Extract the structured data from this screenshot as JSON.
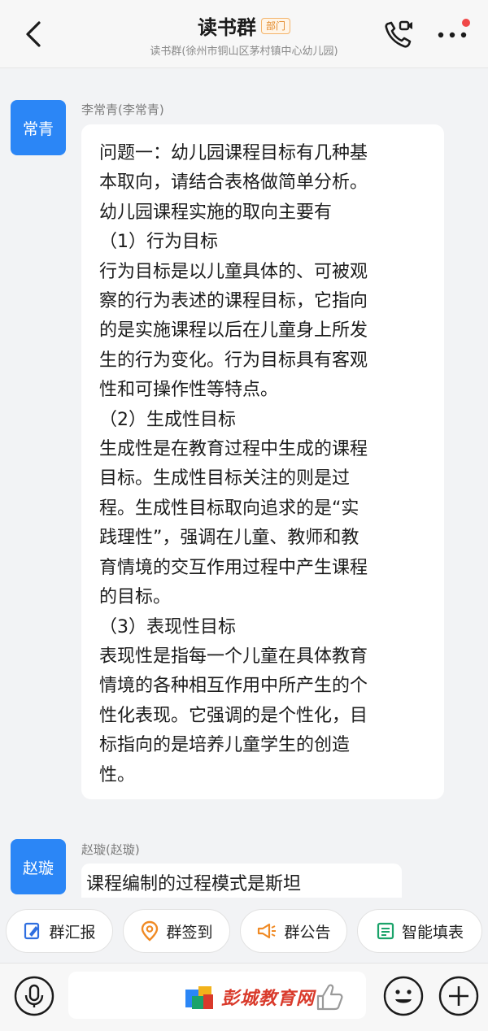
{
  "header": {
    "title": "读书群",
    "tag": "部门",
    "subtitle": "读书群(徐州市铜山区茅村镇中心幼儿园)"
  },
  "messages": [
    {
      "avatar_text": "常青",
      "sender": "李常青(李常青)",
      "lines": [
        "问题一：幼儿园课程目标有几种基",
        "本取向，请结合表格做简单分析。",
        "幼儿园课程实施的取向主要有",
        "（1）行为目标",
        "行为目标是以儿童具体的、可被观",
        "察的行为表述的课程目标，它指向",
        "的是实施课程以后在儿童身上所发",
        "生的行为变化。行为目标具有客观",
        "性和可操作性等特点。",
        "（2）生成性目标",
        "生成性是在教育过程中生成的课程",
        "目标。生成性目标关注的则是过",
        "程。生成性目标取向追求的是“实",
        "践理性”，强调在儿童、教师和教",
        "育情境的交互作用过程中产生课程",
        "的目标。",
        "（3）表现性目标",
        "表现性是指每一个儿童在具体教育",
        "情境的各种相互作用中所产生的个",
        "性化表现。它强调的是个性化，目",
        "标指向的是培养儿童学生的创造",
        "性。"
      ]
    },
    {
      "avatar_text": "赵璇",
      "sender": "赵璇(赵璇)",
      "lines": [
        "课程编制的过程模式是斯坦"
      ]
    }
  ],
  "actions": [
    {
      "label": "群汇报",
      "icon": "report-icon"
    },
    {
      "label": "群签到",
      "icon": "location-pin-icon"
    },
    {
      "label": "群公告",
      "icon": "megaphone-icon"
    },
    {
      "label": "智能填表",
      "icon": "form-icon"
    }
  ],
  "watermark": "彭城教育网",
  "colors": {
    "accent": "#2b86f6",
    "tag_orange": "#e38a2a",
    "action_blue": "#2f6fe0",
    "action_orange": "#f08a24",
    "action_green": "#1aa36a",
    "notification_dot": "#f04848",
    "watermark_red": "#d93a2b"
  }
}
